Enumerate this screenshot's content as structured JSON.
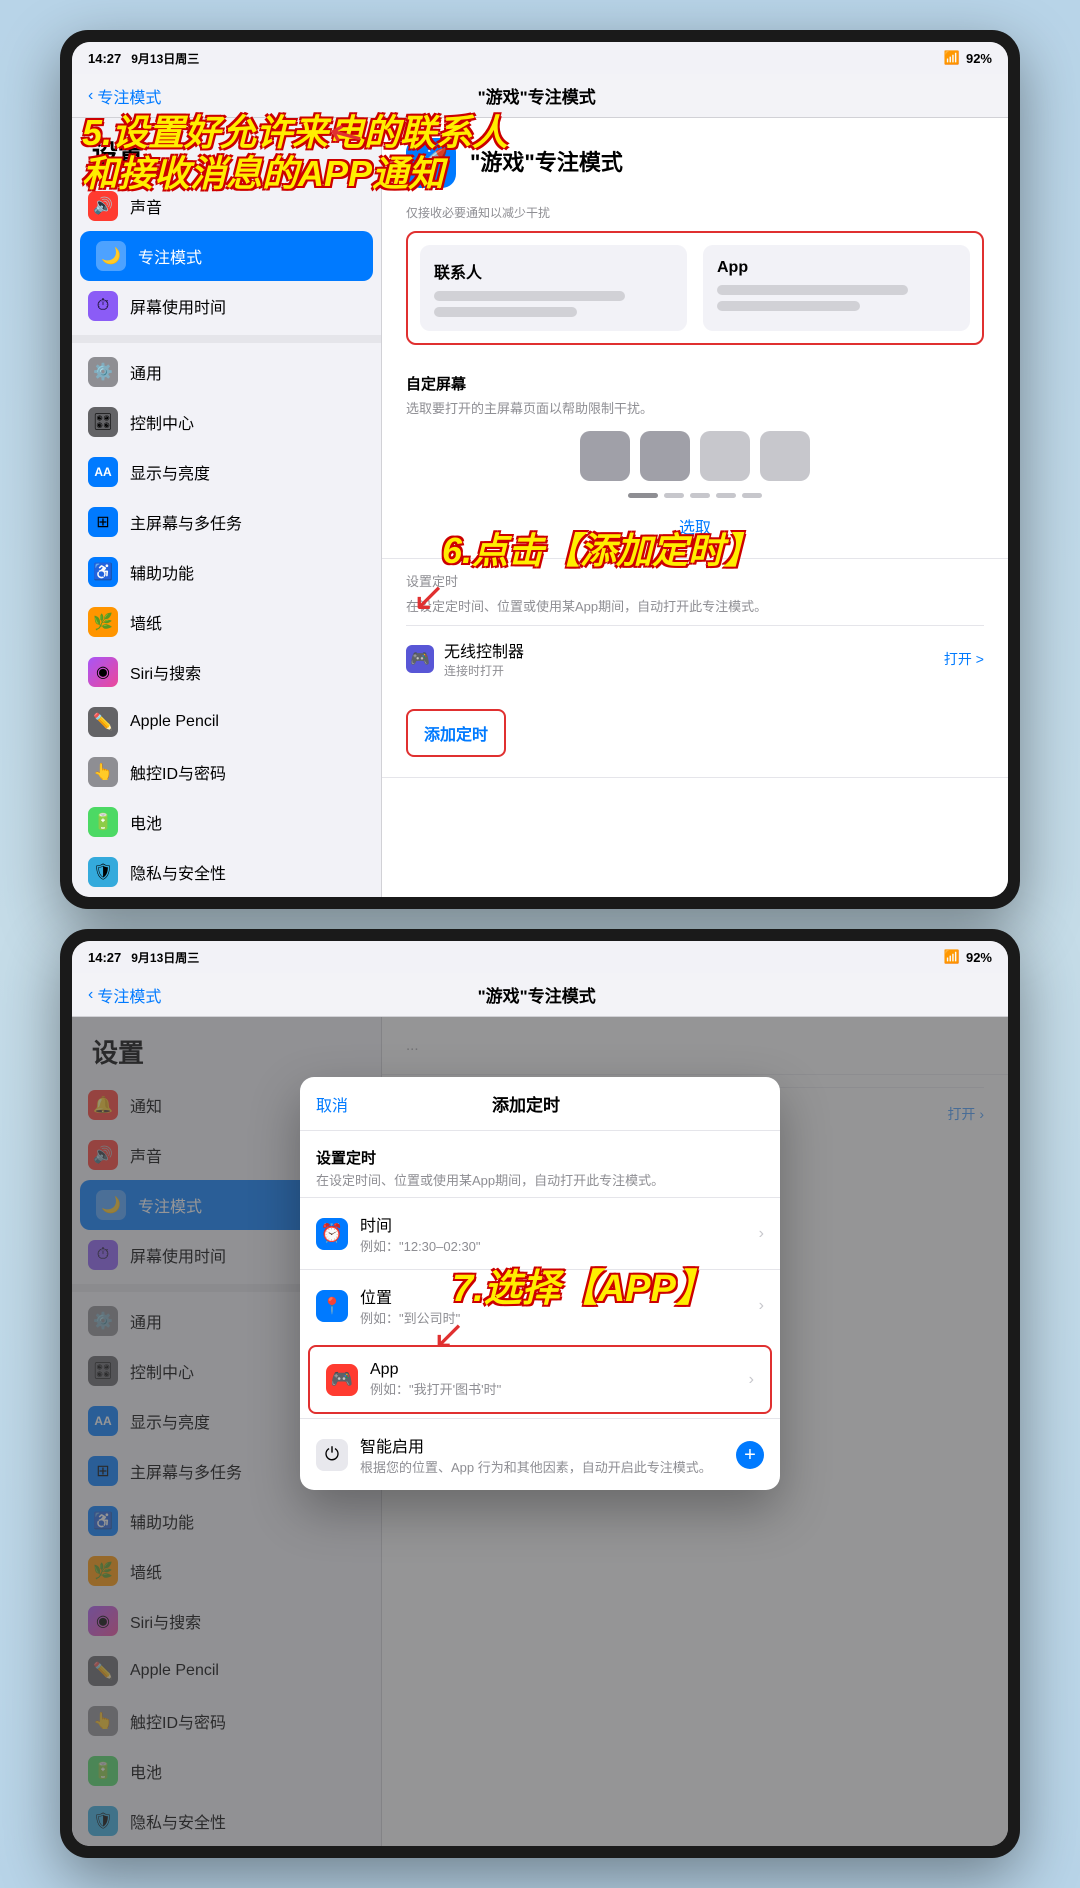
{
  "screen1": {
    "status_bar": {
      "time": "14:27",
      "date": "9月13日周三",
      "wifi": "92%"
    },
    "nav": {
      "back_label": "专注模式",
      "title": "\"游戏\"专注模式"
    },
    "sidebar": {
      "title": "设置",
      "items": [
        {
          "id": "sound",
          "label": "声音",
          "icon": "🔊",
          "color": "icon-sound"
        },
        {
          "id": "focus",
          "label": "专注模式",
          "icon": "🌙",
          "color": "icon-focus",
          "selected": true
        },
        {
          "id": "screen-time",
          "label": "屏幕使用时间",
          "icon": "⏱",
          "color": "icon-screen-time"
        },
        {
          "id": "general",
          "label": "通用",
          "icon": "⚙️",
          "color": "icon-general"
        },
        {
          "id": "control",
          "label": "控制中心",
          "icon": "🎛",
          "color": "icon-control"
        },
        {
          "id": "display",
          "label": "显示与亮度",
          "icon": "AA",
          "color": "icon-display"
        },
        {
          "id": "home",
          "label": "主屏幕与多任务",
          "icon": "⊞",
          "color": "icon-home"
        },
        {
          "id": "accessibility",
          "label": "辅助功能",
          "icon": "♿",
          "color": "icon-accessibility"
        },
        {
          "id": "wallpaper",
          "label": "墙纸",
          "icon": "🌿",
          "color": "icon-wallpaper"
        },
        {
          "id": "siri",
          "label": "Siri与搜索",
          "icon": "◉",
          "color": "icon-siri"
        },
        {
          "id": "pencil",
          "label": "Apple Pencil",
          "icon": "✏️",
          "color": "icon-pencil"
        },
        {
          "id": "touch-id",
          "label": "触控ID与密码",
          "icon": "👆",
          "color": "icon-touch-id"
        },
        {
          "id": "battery",
          "label": "电池",
          "icon": "🔋",
          "color": "icon-battery"
        },
        {
          "id": "privacy",
          "label": "隐私与安全性",
          "icon": "🛡",
          "color": "icon-privacy"
        }
      ]
    },
    "main": {
      "focus_mode_title": "\"游戏\"专注模式",
      "focus_mode_icon": "🚀",
      "allowed_calls_label": "仅接收必要通知以减少干扰",
      "contacts_label": "联系人",
      "app_label": "App",
      "custom_screen_title": "自定屏幕",
      "custom_screen_desc": "选取要打开的主屏幕页面以帮助限制干扰。",
      "select_label": "选取",
      "timer_setup_title": "设置定时",
      "timer_setup_desc": "在设定定时间、位置或使用某App期间，自动打开此专注模式。",
      "wireless_label": "无线控制器",
      "wireless_desc": "连接时打开",
      "wireless_toggle": "打开 >",
      "add_timer_label": "添加定时"
    },
    "step5_text": "5.设置好允许来电的联系人\n和接收消息的APP通知",
    "step6_text": "6.点击【添加定时】"
  },
  "screen2": {
    "status_bar": {
      "time": "14:27",
      "date": "9月13日周三",
      "wifi": "92%"
    },
    "nav": {
      "back_label": "专注模式",
      "title": "\"游戏\"专注模式"
    },
    "sidebar": {
      "title": "设置",
      "items": [
        {
          "id": "notifications",
          "label": "通知",
          "icon": "🔔",
          "color": "icon-notifications"
        },
        {
          "id": "sound",
          "label": "声音",
          "icon": "🔊",
          "color": "icon-sound"
        },
        {
          "id": "focus",
          "label": "专注模式",
          "icon": "🌙",
          "color": "icon-focus",
          "selected": true
        },
        {
          "id": "screen-time",
          "label": "屏幕使用时间",
          "icon": "⏱",
          "color": "icon-screen-time"
        },
        {
          "id": "general",
          "label": "通用",
          "icon": "⚙️",
          "color": "icon-general"
        },
        {
          "id": "control",
          "label": "控制中心",
          "icon": "🎛",
          "color": "icon-control"
        },
        {
          "id": "display",
          "label": "显示与亮度",
          "icon": "AA",
          "color": "icon-display"
        },
        {
          "id": "home",
          "label": "主屏幕与多任务",
          "icon": "⊞",
          "color": "icon-home"
        },
        {
          "id": "accessibility",
          "label": "辅助功能",
          "icon": "♿",
          "color": "icon-accessibility"
        },
        {
          "id": "wallpaper",
          "label": "墙纸",
          "icon": "🌿",
          "color": "icon-wallpaper"
        },
        {
          "id": "siri",
          "label": "Siri与搜索",
          "icon": "◉",
          "color": "icon-siri"
        },
        {
          "id": "pencil",
          "label": "Apple Pencil",
          "icon": "✏️",
          "color": "icon-pencil"
        },
        {
          "id": "touch-id",
          "label": "触控ID与密码",
          "icon": "👆",
          "color": "icon-touch-id"
        },
        {
          "id": "battery",
          "label": "电池",
          "icon": "🔋",
          "color": "icon-battery"
        },
        {
          "id": "privacy",
          "label": "隐私与安全性",
          "icon": "🛡",
          "color": "icon-privacy"
        }
      ]
    },
    "modal": {
      "cancel_label": "取消",
      "title": "添加定时",
      "setup_title": "设置定时",
      "setup_desc": "在设定时间、位置或使用某App期间，自动打开此专注模式。",
      "rows": [
        {
          "id": "time",
          "icon": "⏰",
          "icon_color": "#007aff",
          "title": "时间",
          "subtitle": "例如：\"12:30–02:30\""
        },
        {
          "id": "location",
          "icon": "📍",
          "icon_color": "#007aff",
          "title": "位置",
          "subtitle": "例如：\"到公司时\""
        },
        {
          "id": "app",
          "icon": "🎮",
          "icon_color": "#e03030",
          "title": "App",
          "subtitle": "例如：\"我打开'图书'时\"",
          "highlighted": true
        }
      ],
      "smart_title": "智能启用",
      "smart_desc": "根据您的位置、App 行为和其他因素，自动开启此专注模式。"
    },
    "step7_text": "7.选择【APP】"
  }
}
